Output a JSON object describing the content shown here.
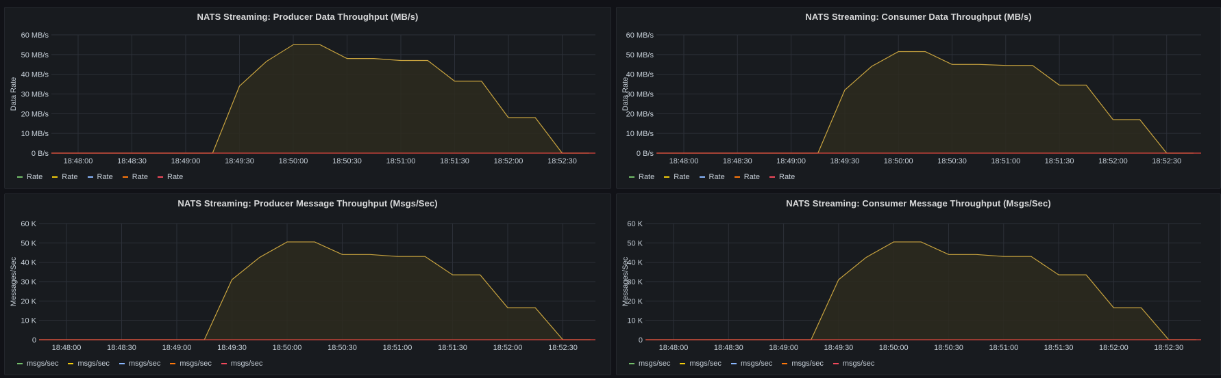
{
  "colors": {
    "background": "#111217",
    "panel": "#181b1f",
    "grid": "#2c3038",
    "fill": "#2d2a1e",
    "series": [
      "#73bf69",
      "#f2cc0c",
      "#8ab8ff",
      "#ff780a",
      "#f2495c"
    ],
    "main_line": "#c9a43f",
    "baseline": "#e0473f"
  },
  "panels": [
    {
      "title": "NATS Streaming: Producer Data Throughput (MB/s)",
      "legend": [
        "Rate",
        "Rate",
        "Rate",
        "Rate",
        "Rate"
      ],
      "chart_data": {
        "type": "area",
        "title": "NATS Streaming: Producer Data Throughput (MB/s)",
        "ylabel": "Data Rate",
        "xlabel": "",
        "x_ticks": [
          "18:48:00",
          "18:48:30",
          "18:49:00",
          "18:49:30",
          "18:50:00",
          "18:50:30",
          "18:51:00",
          "18:51:30",
          "18:52:00",
          "18:52:30"
        ],
        "y_ticks": [
          "0 B/s",
          "10 MB/s",
          "20 MB/s",
          "30 MB/s",
          "40 MB/s",
          "50 MB/s",
          "60 MB/s"
        ],
        "ylim": [
          0,
          60
        ],
        "xlim_sec": [
          -15,
          165
        ],
        "series_time_sec": [
          -15,
          0,
          15,
          30,
          45,
          60,
          75,
          90,
          105,
          120,
          135,
          150,
          165,
          180,
          195,
          210,
          225,
          240,
          255,
          270,
          285
        ],
        "series_values": [
          0,
          0,
          0,
          0,
          0,
          0,
          0,
          34,
          46.5,
          55,
          55,
          48,
          48,
          47,
          47,
          36.5,
          36.5,
          18,
          18,
          0,
          0
        ]
      }
    },
    {
      "title": "NATS Streaming: Consumer Data Throughput (MB/s)",
      "legend": [
        "Rate",
        "Rate",
        "Rate",
        "Rate",
        "Rate"
      ],
      "chart_data": {
        "type": "area",
        "title": "NATS Streaming: Consumer Data Throughput (MB/s)",
        "ylabel": "Data Rate",
        "xlabel": "",
        "x_ticks": [
          "18:48:00",
          "18:48:30",
          "18:49:00",
          "18:49:30",
          "18:50:00",
          "18:50:30",
          "18:51:00",
          "18:51:30",
          "18:52:00",
          "18:52:30"
        ],
        "y_ticks": [
          "0 B/s",
          "10 MB/s",
          "20 MB/s",
          "30 MB/s",
          "40 MB/s",
          "50 MB/s",
          "60 MB/s"
        ],
        "ylim": [
          0,
          60
        ],
        "series_time_sec": [
          -15,
          0,
          15,
          30,
          45,
          60,
          75,
          90,
          105,
          120,
          135,
          150,
          165,
          180,
          195,
          210,
          225,
          240,
          255,
          270,
          285
        ],
        "series_values": [
          0,
          0,
          0,
          0,
          0,
          0,
          0,
          32,
          44,
          51.5,
          51.5,
          45,
          45,
          44.5,
          44.5,
          34.5,
          34.5,
          17,
          17,
          0,
          0
        ]
      }
    },
    {
      "title": "NATS Streaming: Producer Message Throughput (Msgs/Sec)",
      "legend": [
        "msgs/sec",
        "msgs/sec",
        "msgs/sec",
        "msgs/sec",
        "msgs/sec"
      ],
      "chart_data": {
        "type": "area",
        "title": "NATS Streaming: Producer Message Throughput (Msgs/Sec)",
        "ylabel": "Messages/Sec",
        "xlabel": "",
        "x_ticks": [
          "18:48:00",
          "18:48:30",
          "18:49:00",
          "18:49:30",
          "18:50:00",
          "18:50:30",
          "18:51:00",
          "18:51:30",
          "18:52:00",
          "18:52:30"
        ],
        "y_ticks": [
          "0",
          "10 K",
          "20 K",
          "30 K",
          "40 K",
          "50 K",
          "60 K"
        ],
        "ylim": [
          0,
          60
        ],
        "series_time_sec": [
          -15,
          0,
          15,
          30,
          45,
          60,
          75,
          90,
          105,
          120,
          135,
          150,
          165,
          180,
          195,
          210,
          225,
          240,
          255,
          270,
          285
        ],
        "series_values": [
          0,
          0,
          0,
          0,
          0,
          0,
          0,
          31,
          42.5,
          50.5,
          50.5,
          44,
          44,
          43,
          43,
          33.5,
          33.5,
          16.5,
          16.5,
          0,
          0
        ]
      }
    },
    {
      "title": "NATS Streaming: Consumer Message Throughput (Msgs/Sec)",
      "legend": [
        "msgs/sec",
        "msgs/sec",
        "msgs/sec",
        "msgs/sec",
        "msgs/sec"
      ],
      "chart_data": {
        "type": "area",
        "title": "NATS Streaming: Consumer Message Throughput (Msgs/Sec)",
        "ylabel": "Messages/Sec",
        "xlabel": "",
        "x_ticks": [
          "18:48:00",
          "18:48:30",
          "18:49:00",
          "18:49:30",
          "18:50:00",
          "18:50:30",
          "18:51:00",
          "18:51:30",
          "18:52:00",
          "18:52:30"
        ],
        "y_ticks": [
          "0",
          "10 K",
          "20 K",
          "30 K",
          "40 K",
          "50 K",
          "60 K"
        ],
        "ylim": [
          0,
          60
        ],
        "series_time_sec": [
          -15,
          0,
          15,
          30,
          45,
          60,
          75,
          90,
          105,
          120,
          135,
          150,
          165,
          180,
          195,
          210,
          225,
          240,
          255,
          270,
          285
        ],
        "series_values": [
          0,
          0,
          0,
          0,
          0,
          0,
          0,
          31,
          42.5,
          50.5,
          50.5,
          44,
          44,
          43,
          43,
          33.5,
          33.5,
          16.5,
          16.5,
          0,
          0
        ]
      }
    }
  ]
}
